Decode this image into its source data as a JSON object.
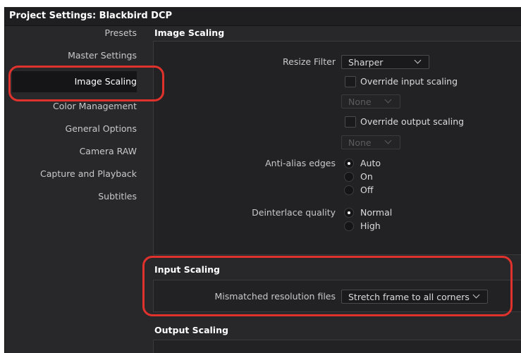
{
  "window": {
    "title": "Project Settings:  Blackbird DCP"
  },
  "sidebar": {
    "items": [
      {
        "label": "Presets"
      },
      {
        "label": "Master Settings"
      },
      {
        "label": "Image Scaling"
      },
      {
        "label": "Color Management"
      },
      {
        "label": "General Options"
      },
      {
        "label": "Camera RAW"
      },
      {
        "label": "Capture and Playback"
      },
      {
        "label": "Subtitles"
      }
    ],
    "selected": "Image Scaling"
  },
  "image_scaling": {
    "heading": "Image Scaling",
    "resize_filter": {
      "label": "Resize Filter",
      "value": "Sharper"
    },
    "override_input": {
      "label": "Override input scaling",
      "checked": false,
      "value": "None"
    },
    "override_output": {
      "label": "Override output scaling",
      "checked": false,
      "value": "None"
    },
    "anti_alias": {
      "label": "Anti-alias edges",
      "options": [
        "Auto",
        "On",
        "Off"
      ],
      "selected": "Auto"
    },
    "deinterlace": {
      "label": "Deinterlace quality",
      "options": [
        "Normal",
        "High"
      ],
      "selected": "Normal"
    }
  },
  "input_scaling": {
    "heading": "Input Scaling",
    "mismatched": {
      "label": "Mismatched resolution files",
      "value": "Stretch frame to all corners"
    }
  },
  "output_scaling": {
    "heading": "Output Scaling"
  },
  "colors": {
    "highlight": "#e0322c",
    "background": "#28282b",
    "panel": "#222224"
  }
}
